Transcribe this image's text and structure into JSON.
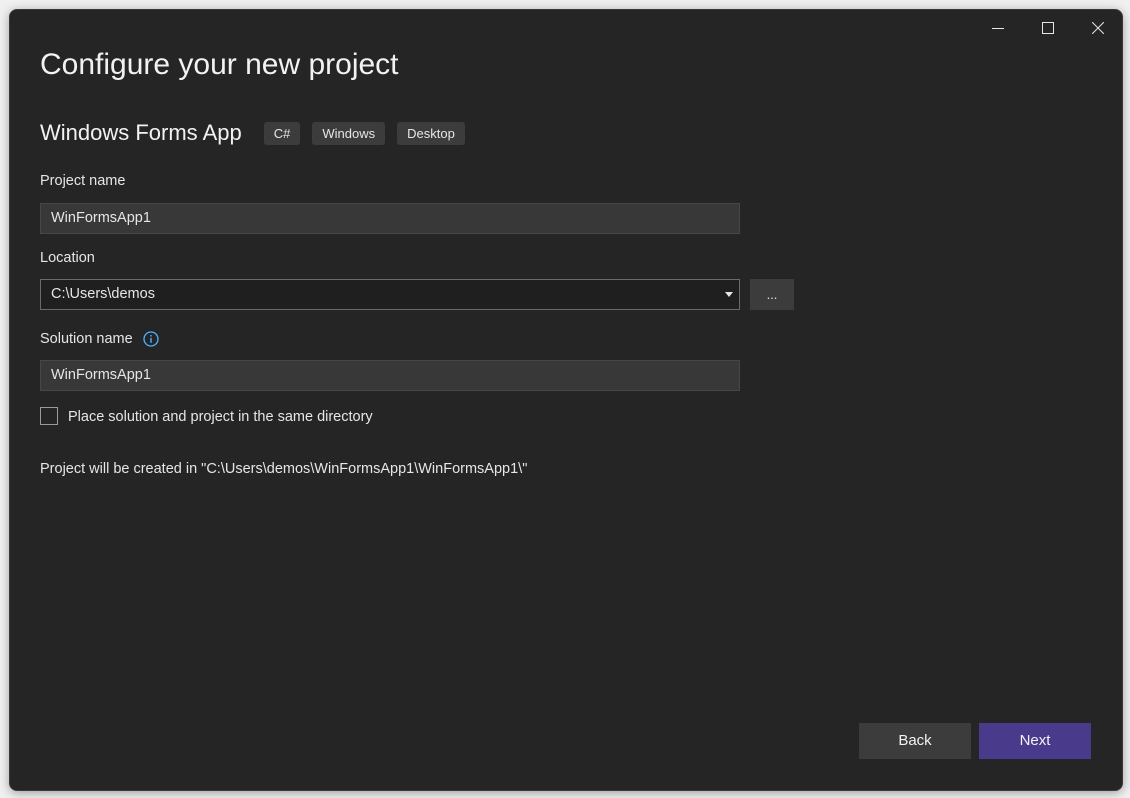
{
  "window": {
    "controls": {
      "minimize_icon": "minimize-icon",
      "maximize_icon": "maximize-icon",
      "close_icon": "close-icon"
    }
  },
  "header": {
    "title": "Configure your new project"
  },
  "template": {
    "name": "Windows Forms App",
    "tags": [
      "C#",
      "Windows",
      "Desktop"
    ]
  },
  "form": {
    "project_name": {
      "label": "Project name",
      "value": "WinFormsApp1"
    },
    "location": {
      "label": "Location",
      "value": "C:\\Users\\demos",
      "browse_label": "..."
    },
    "solution_name": {
      "label": "Solution name",
      "value": "WinFormsApp1",
      "info_icon": "info-icon"
    },
    "same_directory": {
      "label": "Place solution and project in the same directory",
      "checked": false
    },
    "path_note": "Project will be created in \"C:\\Users\\demos\\WinFormsApp1\\WinFormsApp1\\\""
  },
  "footer": {
    "back_label": "Back",
    "next_label": "Next"
  },
  "colors": {
    "background": "#252526",
    "input_background": "#383838",
    "button_background": "#3c3c3c",
    "accent": "#4a3a8c",
    "info_accent": "#4fb3ff"
  }
}
